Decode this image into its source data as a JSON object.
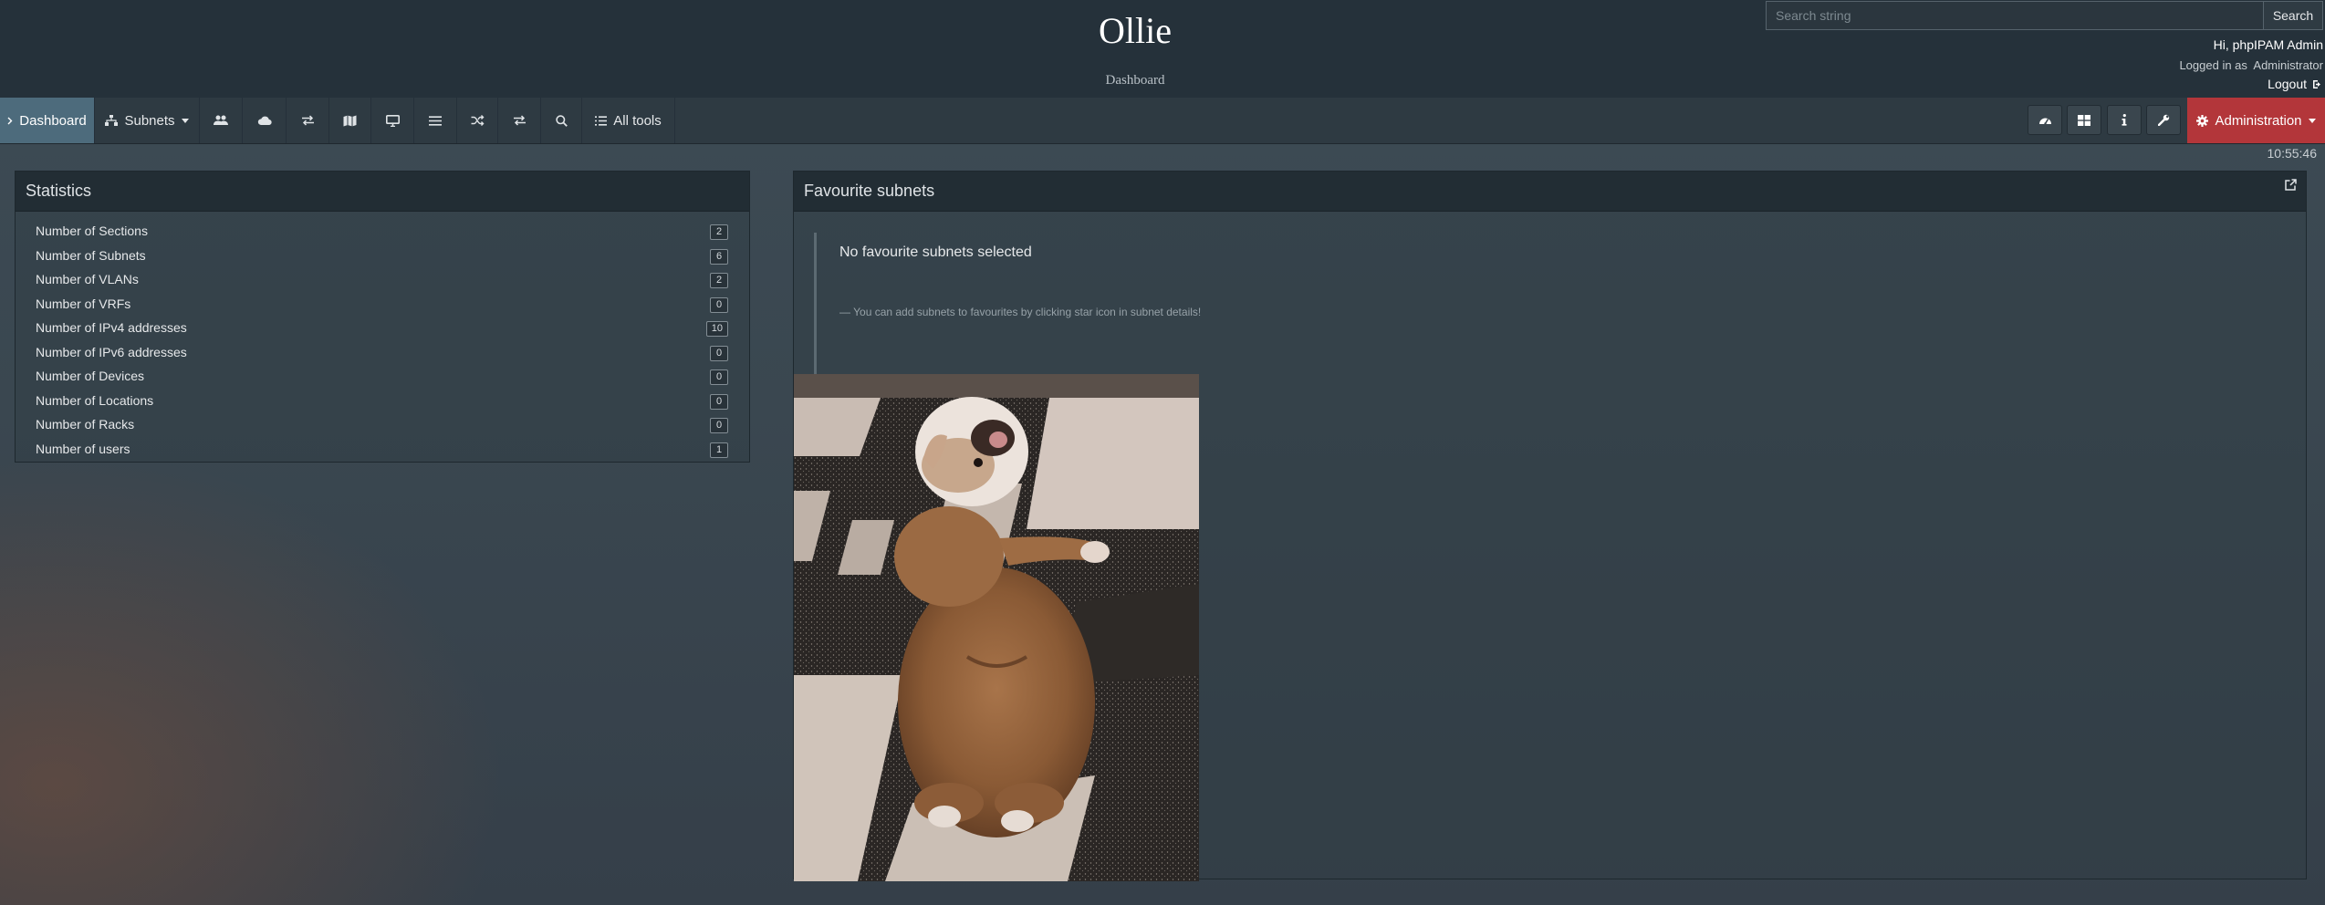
{
  "header": {
    "title": "Ollie",
    "subtitle": "Dashboard",
    "search_placeholder": "Search string",
    "search_button": "Search",
    "greeting": "Hi, phpIPAM Admin",
    "role": "Logged in as  Administrator",
    "logout": "Logout"
  },
  "nav": {
    "dashboard": "Dashboard",
    "subnets": "Subnets",
    "all_tools": "All tools",
    "administration": "Administration",
    "icons": [
      "users-icon",
      "cloud-icon",
      "exchange-icon",
      "map-icon",
      "desktop-icon",
      "list-icon",
      "random-icon",
      "exchange-icon",
      "search-icon"
    ],
    "tool_icons": [
      "dashboard-icon",
      "grid-icon",
      "info-icon",
      "wrench-icon"
    ]
  },
  "clock": "10:55:46",
  "statistics": {
    "title": "Statistics",
    "rows": [
      {
        "label": "Number of Sections",
        "value": "2"
      },
      {
        "label": "Number of Subnets",
        "value": "6"
      },
      {
        "label": "Number of VLANs",
        "value": "2"
      },
      {
        "label": "Number of VRFs",
        "value": "0"
      },
      {
        "label": "Number of IPv4 addresses",
        "value": "10"
      },
      {
        "label": "Number of IPv6 addresses",
        "value": "0"
      },
      {
        "label": "Number of Devices",
        "value": "0"
      },
      {
        "label": "Number of Locations",
        "value": "0"
      },
      {
        "label": "Number of Racks",
        "value": "0"
      },
      {
        "label": "Number of users",
        "value": "1"
      }
    ]
  },
  "favourites": {
    "title": "Favourite subnets",
    "empty_title": "No favourite subnets selected",
    "hint": "— You can add subnets to favourites by clicking star icon in subnet details!"
  },
  "colors": {
    "header_bg": "#25313a",
    "nav_bg": "#2e3a42",
    "active_nav": "#4d6b7c",
    "admin_button": "#b3363a"
  }
}
